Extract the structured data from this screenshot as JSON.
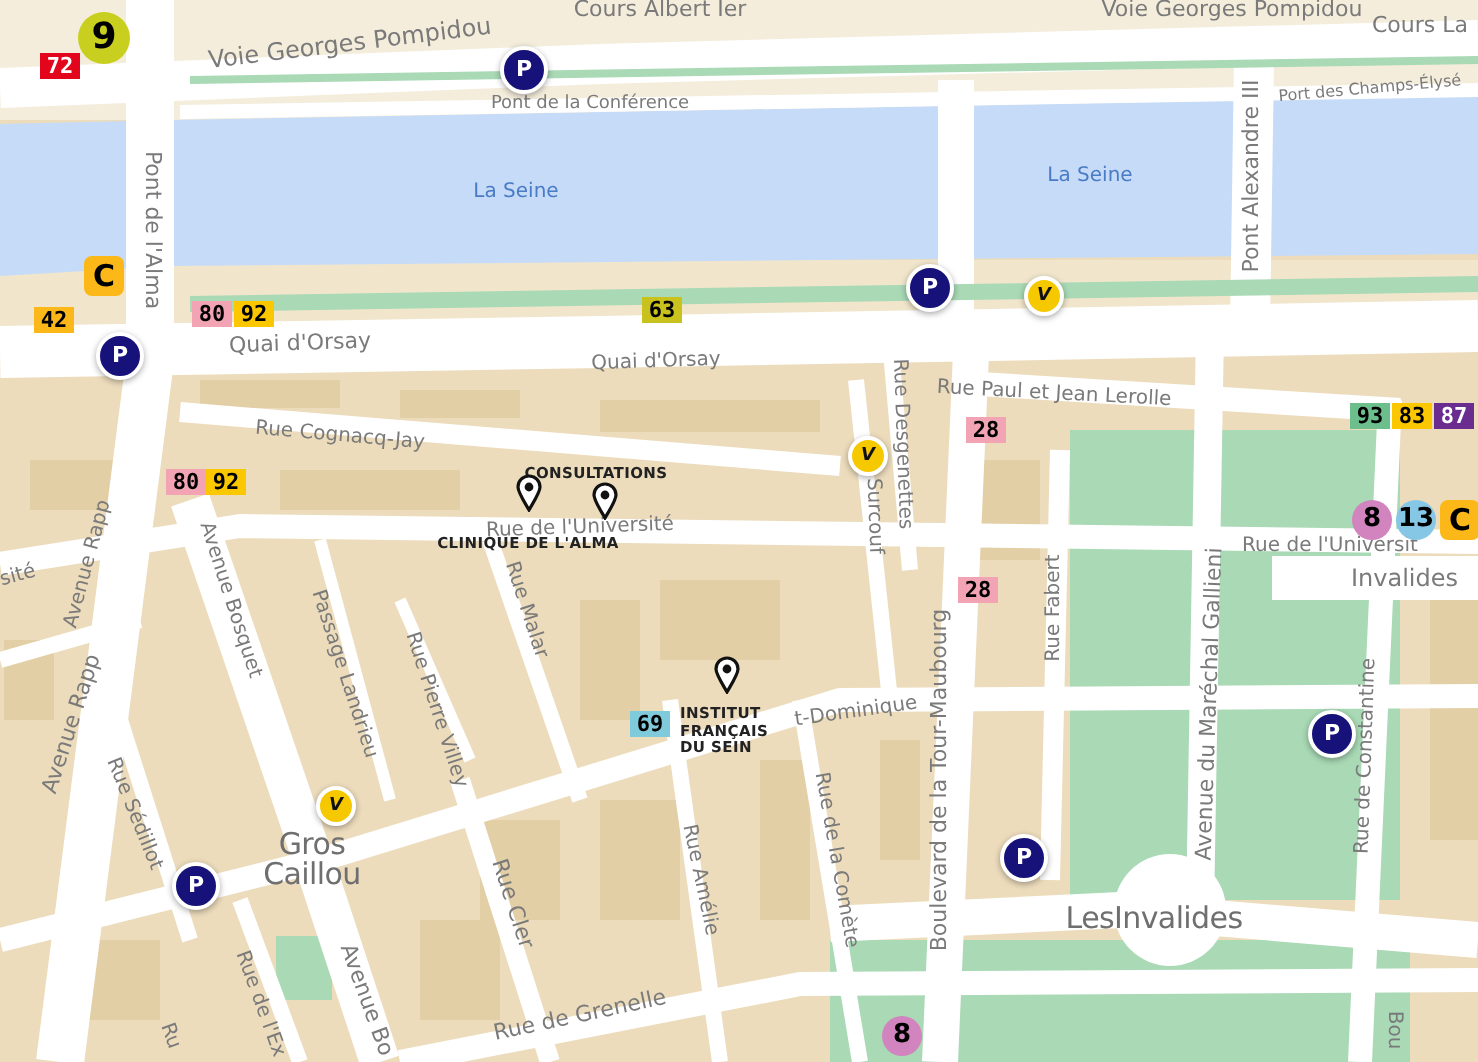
{
  "map": {
    "water_labels": [
      "La Seine",
      "La Seine"
    ],
    "streets": [
      "Cours Albert Ier",
      "Voie Georges Pompidou",
      "Cours La",
      "Voie Georges Pompidou",
      "Pont de la Conférence",
      "Port des Champs-Élysé",
      "Pont de l'Alma",
      "Pont Alexandre III",
      "Quai d'Orsay",
      "Quai d'Orsay",
      "Rue Cognacq-Jay",
      "Rue de l'Université",
      "Rue Paul et Jean Lerolle",
      "Rue Desgenettes",
      "Surcouf",
      "sité",
      "Avenue Rapp",
      "Avenue Bosquet",
      "Passage Landrieu",
      "Rue Pierre Villey",
      "Rue Malar",
      "Rue Fabert",
      "t-Dominique",
      "Avenue Rapp",
      "Rue Sédillot",
      "Rue de la Comète",
      "Boulevard de la Tour-Maubourg",
      "Avenue du Maréchal Gallieni",
      "Rue de Constantine",
      "Rue Cler",
      "Rue Amélie",
      "Rue de Grenelle",
      "Rue de l'Ex",
      "Avenue Bo",
      "Ru",
      "Bou",
      "Rue de l'Universit"
    ],
    "places": [
      "Gros Caillou",
      "LesInvalides"
    ],
    "station_label": "Invalides",
    "transit_badges": [
      {
        "text": "9",
        "kind": "metro",
        "color": "#c9cf1f"
      },
      {
        "text": "72",
        "kind": "bus",
        "color": "#e3051b"
      },
      {
        "text": "C",
        "kind": "rer",
        "color": "#fbb818"
      },
      {
        "text": "42",
        "kind": "bus",
        "color": "#fbb818"
      },
      {
        "text": "80",
        "kind": "bus",
        "color": "#f2a4b4"
      },
      {
        "text": "92",
        "kind": "bus",
        "color": "#fbc800"
      },
      {
        "text": "63",
        "kind": "bus",
        "color": "#c9c21e"
      },
      {
        "text": "80",
        "kind": "bus",
        "color": "#f2a4b4"
      },
      {
        "text": "92",
        "kind": "bus",
        "color": "#fbc800"
      },
      {
        "text": "28",
        "kind": "bus",
        "color": "#f2a4b4"
      },
      {
        "text": "28",
        "kind": "bus",
        "color": "#f2a4b4"
      },
      {
        "text": "93",
        "kind": "bus",
        "color": "#6cbf8c"
      },
      {
        "text": "83",
        "kind": "bus",
        "color": "#fbc800"
      },
      {
        "text": "87",
        "kind": "bus",
        "color": "#6a2c8f"
      },
      {
        "text": "8",
        "kind": "metro",
        "color": "#d184bd"
      },
      {
        "text": "13",
        "kind": "metro",
        "color": "#86c7e5"
      },
      {
        "text": "C",
        "kind": "rer",
        "color": "#fbb818"
      },
      {
        "text": "69",
        "kind": "bus",
        "color": "#7fcbdb"
      },
      {
        "text": "8",
        "kind": "metro",
        "color": "#d184bd"
      }
    ],
    "markers": [
      {
        "kind": "parking",
        "symbol": "P"
      },
      {
        "kind": "parking",
        "symbol": "P"
      },
      {
        "kind": "parking",
        "symbol": "P"
      },
      {
        "kind": "parking",
        "symbol": "P"
      },
      {
        "kind": "parking",
        "symbol": "P"
      },
      {
        "kind": "parking",
        "symbol": "P"
      },
      {
        "kind": "bike",
        "symbol": "V"
      },
      {
        "kind": "bike",
        "symbol": "V"
      },
      {
        "kind": "bike",
        "symbol": "V"
      }
    ],
    "points_of_interest": [
      "CONSULTATIONS",
      "CLINIQUE DE L'ALMA",
      "INSTITUT FRANÇAIS DU SEIN"
    ]
  }
}
